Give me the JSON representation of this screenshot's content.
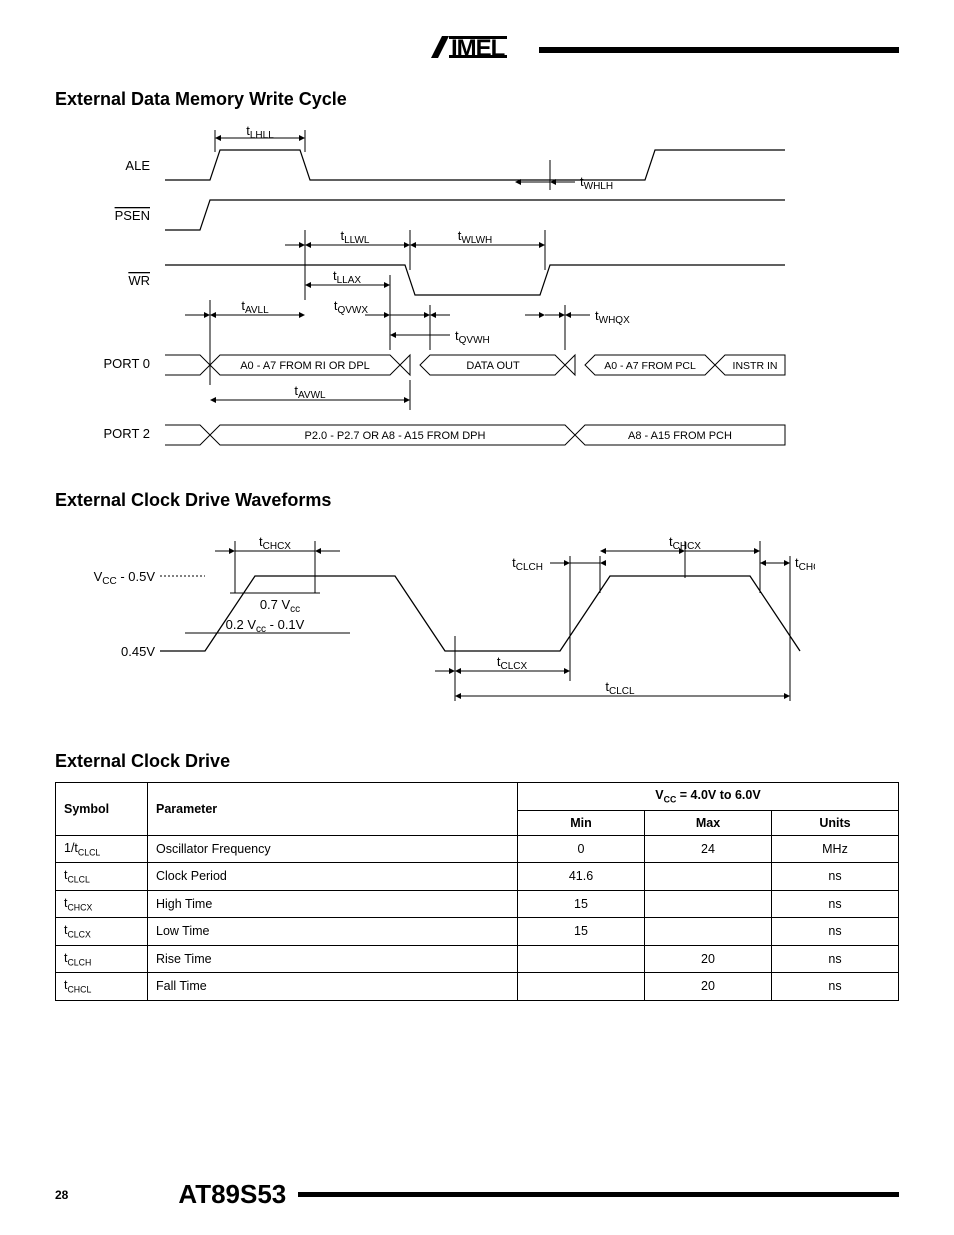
{
  "header": {
    "logo_alt": "AIMEL"
  },
  "sections": {
    "s1": {
      "title": "External Data Memory Write Cycle"
    },
    "s2": {
      "title": "External Clock Drive Waveforms"
    },
    "s3": {
      "title": "External Clock Drive"
    }
  },
  "diagram1": {
    "signals": {
      "ale": "ALE",
      "psen": "PSEN",
      "wr": "WR",
      "port0": "PORT 0",
      "port2": "PORT 2"
    },
    "timings": {
      "tLHLL": "t",
      "tLHLL_sub": "LHLL",
      "tWHLH": "t",
      "tWHLH_sub": "WHLH",
      "tLLWL": "t",
      "tLLWL_sub": "LLWL",
      "tWLWH": "t",
      "tWLWH_sub": "WLWH",
      "tLLAX": "t",
      "tLLAX_sub": "LLAX",
      "tAVLL": "t",
      "tAVLL_sub": "AVLL",
      "tQVWX": "t",
      "tQVWX_sub": "QVWX",
      "tWHQX": "t",
      "tWHQX_sub": "WHQX",
      "tQVWH": "t",
      "tQVWH_sub": "QVWH",
      "tAVWL": "t",
      "tAVWL_sub": "AVWL"
    },
    "bus": {
      "p0a": "A0 - A7 FROM RI OR DPL",
      "p0b": "DATA OUT",
      "p0c": "A0 - A7 FROM PCL",
      "p0d": "INSTR IN",
      "p2a": "P2.0 - P2.7 OR A8 - A15 FROM DPH",
      "p2b": "A8 - A15 FROM PCH"
    }
  },
  "diagram2": {
    "levels": {
      "vcc_minus": "V",
      "vcc_minus_rest": " - 0.5V",
      "vcc_sub": "CC",
      "v045": "0.45V",
      "v07vcc": "0.7 V",
      "v07vcc_sub": "cc",
      "v02vcc": "0.2 V",
      "v02vcc_sub": "cc",
      "v02vcc_rest": " - 0.1V"
    },
    "timings": {
      "tCHCX": "t",
      "tCHCX_sub": "CHCX",
      "tCLCH": "t",
      "tCLCH_sub": "CLCH",
      "tCHCL": "t",
      "tCHCL_sub": "CHCL",
      "tCLCX": "t",
      "tCLCX_sub": "CLCX",
      "tCLCL": "t",
      "tCLCL_sub": "CLCL"
    }
  },
  "table": {
    "headers": {
      "symbol": "Symbol",
      "parameter": "Parameter",
      "condition": "V",
      "condition_sub": "CC",
      "condition_rest": " = 4.0V to 6.0V",
      "min": "Min",
      "max": "Max",
      "units": "Units"
    },
    "rows": [
      {
        "symbol_pre": "1/t",
        "symbol_sub": "CLCL",
        "parameter": "Oscillator Frequency",
        "min": "0",
        "max": "24",
        "units": "MHz"
      },
      {
        "symbol_pre": "t",
        "symbol_sub": "CLCL",
        "parameter": "Clock Period",
        "min": "41.6",
        "max": "",
        "units": "ns"
      },
      {
        "symbol_pre": "t",
        "symbol_sub": "CHCX",
        "parameter": "High Time",
        "min": "15",
        "max": "",
        "units": "ns"
      },
      {
        "symbol_pre": "t",
        "symbol_sub": "CLCX",
        "parameter": "Low Time",
        "min": "15",
        "max": "",
        "units": "ns"
      },
      {
        "symbol_pre": "t",
        "symbol_sub": "CLCH",
        "parameter": "Rise Time",
        "min": "",
        "max": "20",
        "units": "ns"
      },
      {
        "symbol_pre": "t",
        "symbol_sub": "CHCL",
        "parameter": "Fall Time",
        "min": "",
        "max": "20",
        "units": "ns"
      }
    ]
  },
  "footer": {
    "page": "28",
    "part": "AT89S53"
  }
}
